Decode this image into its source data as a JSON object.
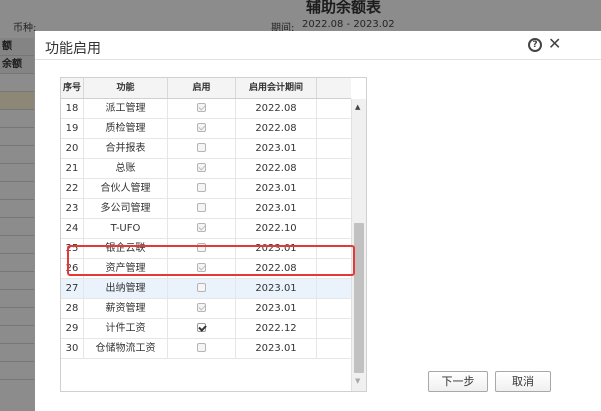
{
  "background": {
    "report_title": "辅助余额表",
    "currency_label": "币种:",
    "period_label": "期间:",
    "period_value": "2022.08 - 2023.02",
    "grid_headers": [
      "额",
      "余额"
    ]
  },
  "dialog": {
    "title": "功能启用",
    "help_icon": "question-circle-icon",
    "close_icon": "close-icon",
    "columns": [
      "序号",
      "功能",
      "启用",
      "启用会计期间"
    ],
    "rows": [
      {
        "no": "18",
        "name": "派工管理",
        "enabled": "disabled-checked",
        "period": "2022.08"
      },
      {
        "no": "19",
        "name": "质检管理",
        "enabled": "disabled-checked",
        "period": "2022.08"
      },
      {
        "no": "20",
        "name": "合并报表",
        "enabled": "unchecked",
        "period": "2023.01"
      },
      {
        "no": "21",
        "name": "总账",
        "enabled": "disabled-checked",
        "period": "2022.08"
      },
      {
        "no": "22",
        "name": "合伙人管理",
        "enabled": "unchecked",
        "period": "2023.01"
      },
      {
        "no": "23",
        "name": "多公司管理",
        "enabled": "unchecked",
        "period": "2023.01"
      },
      {
        "no": "24",
        "name": "T-UFO",
        "enabled": "disabled-checked",
        "period": "2022.10"
      },
      {
        "no": "25",
        "name": "银企云联",
        "enabled": "unchecked",
        "period": "2023.01"
      },
      {
        "no": "26",
        "name": "资产管理",
        "enabled": "disabled-checked",
        "period": "2022.08"
      },
      {
        "no": "27",
        "name": "出纳管理",
        "enabled": "unchecked",
        "period": "2023.01"
      },
      {
        "no": "28",
        "name": "薪资管理",
        "enabled": "disabled-checked",
        "period": "2023.01"
      },
      {
        "no": "29",
        "name": "计件工资",
        "enabled": "checked",
        "period": "2022.12"
      },
      {
        "no": "30",
        "name": "仓储物流工资",
        "enabled": "unchecked",
        "period": "2023.01"
      }
    ],
    "highlighted_row": "27",
    "buttons": {
      "next": "下一步",
      "cancel": "取消"
    },
    "annotation_color": "#e53935"
  }
}
